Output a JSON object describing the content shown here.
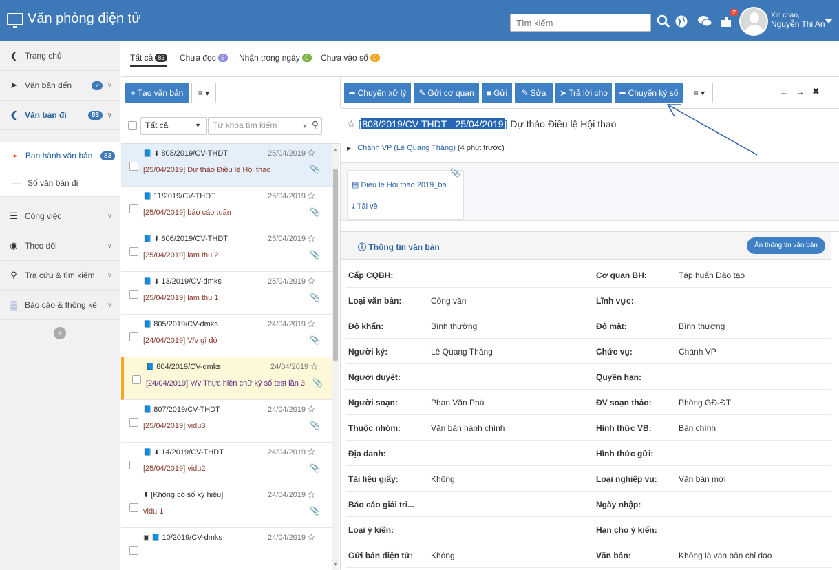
{
  "header": {
    "app_title": "Văn phòng điện tử",
    "search_placeholder": "Tìm kiếm",
    "notification_count": "2",
    "greeting": "Xin chào,",
    "user_name": "Nguyễn Thị An"
  },
  "sidebar": {
    "items": [
      {
        "label": "Trang chủ"
      },
      {
        "label": "Văn bản đến",
        "count": "2"
      },
      {
        "label": "Văn bản đi",
        "count": "83"
      },
      {
        "label": "Ban hành văn bản",
        "count": "83"
      },
      {
        "label": "Sổ văn bản đi"
      },
      {
        "label": "Công việc"
      },
      {
        "label": "Theo dõi"
      },
      {
        "label": "Tra cứu & tìm kiếm"
      },
      {
        "label": "Báo cáo & thống kê"
      }
    ]
  },
  "tabs": [
    {
      "label": "Tất cả",
      "count": "83"
    },
    {
      "label": "Chưa đọc",
      "count": "6"
    },
    {
      "label": "Nhận trong ngày",
      "count": "0"
    },
    {
      "label": "Chưa vào sổ",
      "count": "0"
    }
  ],
  "list": {
    "create_label": "Tạo văn bản",
    "filter_select": "Tất cả",
    "keyword_placeholder": "Từ khóa tìm kiếm",
    "rows": [
      {
        "code": "808/2019/CV-THDT",
        "date": "25/04/2019",
        "title": "[25/04/2019] Dự thảo Điều lệ Hội thao"
      },
      {
        "code": "11/2019/CV-THDT",
        "date": "25/04/2019",
        "title": "[25/04/2019] báo cáo tuần"
      },
      {
        "code": "806/2019/CV-THDT",
        "date": "25/04/2019",
        "title": "[25/04/2019] lam thu 2"
      },
      {
        "code": "13/2019/CV-dmks",
        "date": "25/04/2019",
        "title": "[25/04/2019] lam thu 1"
      },
      {
        "code": "805/2019/CV-dmks",
        "date": "24/04/2019",
        "title": "[24/04/2019] V/v gì đó"
      },
      {
        "code": "804/2019/CV-dmks",
        "date": "24/04/2019",
        "title": "[24/04/2019] V/v Thực hiện chữ ký số test lần 3"
      },
      {
        "code": "807/2019/CV-THDT",
        "date": "24/04/2019",
        "title": "[25/04/2019] vidu3"
      },
      {
        "code": "14/2019/CV-THDT",
        "date": "24/04/2019",
        "title": "[25/04/2019] vidu2"
      },
      {
        "code": "[Không có số ký hiệu]",
        "date": "24/04/2019",
        "title": "vidu 1"
      },
      {
        "code": "10/2019/CV-dmks",
        "date": "24/04/2019",
        "title": ""
      }
    ]
  },
  "toolbar": {
    "forward": "Chuyển xử lý",
    "send_agency": "Gửi cơ quan",
    "send": "Gửi",
    "edit": "Sửa",
    "reply": "Trả lời cho",
    "sign": "Chuyển ký số"
  },
  "detail": {
    "title_code": "808/2019/CV-THDT - 25/04/2019",
    "title_text": "Dự thảo Điều lệ Hội thao",
    "from_link": "Chánh VP (Lê Quang Thắng)",
    "from_time": "(4 phút trước)",
    "attachment_name": "Dieu le Hoi thao 2019_ba...",
    "download_label": "Tải về",
    "info_title": "Thông tin văn bản",
    "hide_info_label": "Ẩn thông tin văn bản",
    "rows": [
      {
        "k1": "Cấp CQBH:",
        "v1": "",
        "k2": "Cơ quan BH:",
        "v2": "Tập huấn Đào tạo"
      },
      {
        "k1": "Loại văn bản:",
        "v1": "Công văn",
        "k2": "Lĩnh vực:",
        "v2": ""
      },
      {
        "k1": "Độ khẩn:",
        "v1": "Bình thường",
        "k2": "Độ mật:",
        "v2": "Bình thường"
      },
      {
        "k1": "Người ký:",
        "v1": "Lê Quang Thắng",
        "k2": "Chức vụ:",
        "v2": "Chánh VP"
      },
      {
        "k1": "Người duyệt:",
        "v1": "",
        "k2": "Quyền hạn:",
        "v2": ""
      },
      {
        "k1": "Người soạn:",
        "v1": "Phan Văn Phú",
        "k2": "ĐV soạn thảo:",
        "v2": "Phòng GĐ-ĐT"
      },
      {
        "k1": "Thuộc nhóm:",
        "v1": "Văn bản hành chính",
        "k2": "Hình thức VB:",
        "v2": "Bản chính"
      },
      {
        "k1": "Địa danh:",
        "v1": "",
        "k2": "Hình thức gửi:",
        "v2": ""
      },
      {
        "k1": "Tài liệu giấy:",
        "v1": "Không",
        "k2": "Loại nghiệp vụ:",
        "v2": "Văn bản mới"
      },
      {
        "k1": "Báo cáo giải tri...",
        "v1": "",
        "k2": "Ngày nhập:",
        "v2": ""
      },
      {
        "k1": "Loại ý kiến:",
        "v1": "",
        "k2": "Hạn cho ý kiến:",
        "v2": ""
      },
      {
        "k1": "Gửi bản điện tử:",
        "v1": "Không",
        "k2": "Văn bản:",
        "v2": "Không là văn bản chỉ đạo"
      }
    ]
  },
  "colors": {
    "brand": "#3d79b8",
    "button": "#3f80c4",
    "selected_row": "#e5effa",
    "highlight_row": "#fdf8d7",
    "highlight_bar": "#f5a623"
  }
}
